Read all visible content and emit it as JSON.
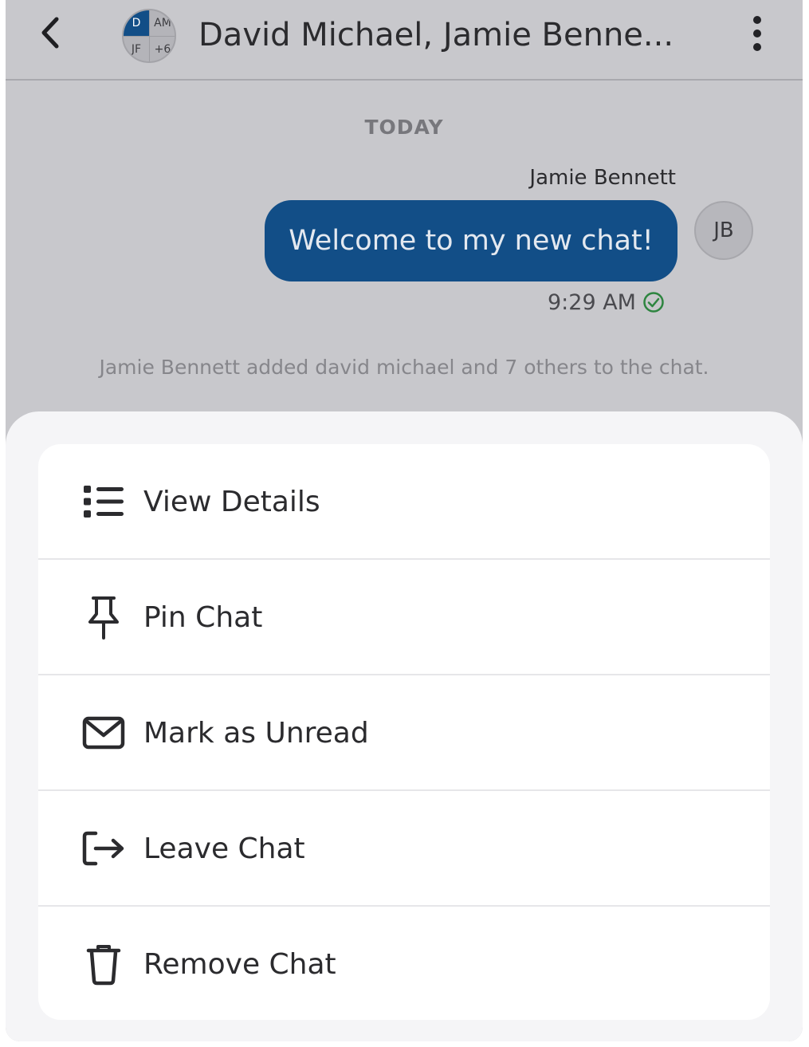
{
  "header": {
    "title": "David Michael, Jamie Benne...",
    "group_avatar": {
      "tl": "D",
      "tr": "AM",
      "bl": "JF",
      "br": "+6"
    },
    "back_icon": "chevron-left-icon",
    "more_icon": "more-vertical-icon"
  },
  "conversation": {
    "date_separator": "TODAY",
    "messages": [
      {
        "sender": "Jamie Bennett",
        "text": "Welcome to my new chat!",
        "avatar_initials": "JB",
        "time": "9:29 AM",
        "status_icon": "check-circle-icon"
      }
    ],
    "system_message": "Jamie Bennett added david michael and 7 others to the chat."
  },
  "action_sheet": {
    "items": [
      {
        "label": "View Details",
        "icon": "list-icon"
      },
      {
        "label": "Pin Chat",
        "icon": "pin-icon"
      },
      {
        "label": "Mark as Unread",
        "icon": "envelope-icon"
      },
      {
        "label": "Leave Chat",
        "icon": "leave-icon"
      },
      {
        "label": "Remove Chat",
        "icon": "trash-icon"
      }
    ]
  },
  "colors": {
    "brand_blue": "#124e87",
    "overlay_bg": "#c8c8cc",
    "sheet_bg": "#f5f5f7",
    "read_check": "#2e8540"
  }
}
